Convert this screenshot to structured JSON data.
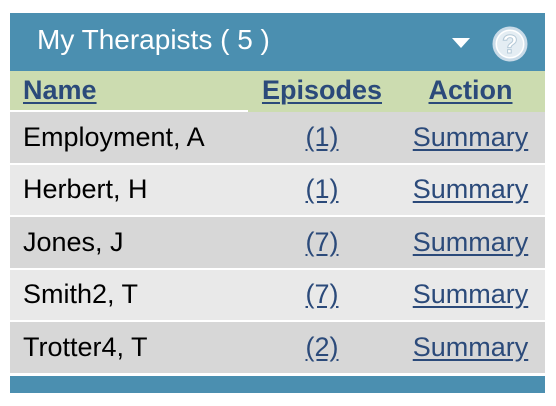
{
  "panel": {
    "title": "My Therapists ( 5 )",
    "dropdown_icon": "chevron-down-icon",
    "help_icon": "question-mark-icon",
    "help_label": "?"
  },
  "table": {
    "headers": {
      "name": "Name",
      "episodes": "Episodes",
      "action": "Action"
    },
    "rows": [
      {
        "name": "Employment, A",
        "episodes": "(1)",
        "action": "Summary"
      },
      {
        "name": "Herbert, H",
        "episodes": "(1)",
        "action": "Summary"
      },
      {
        "name": "Jones, J",
        "episodes": "(7)",
        "action": "Summary"
      },
      {
        "name": "Smith2, T",
        "episodes": "(7)",
        "action": "Summary"
      },
      {
        "name": "Trotter4, T",
        "episodes": "(2)",
        "action": "Summary"
      }
    ]
  },
  "colors": {
    "header_bg": "#4b8fb0",
    "column_header_bg": "#ccdcb0",
    "link": "#2b4a7a",
    "row_odd": "#d7d7d7",
    "row_even": "#e9e9e9"
  }
}
